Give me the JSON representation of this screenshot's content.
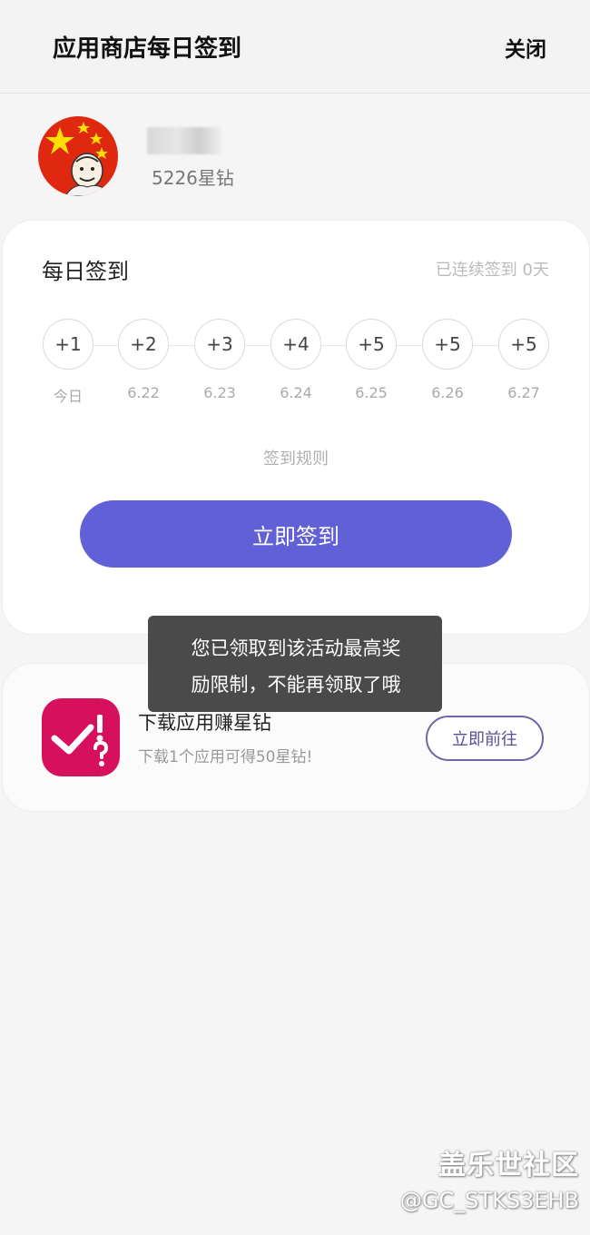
{
  "header": {
    "title": "应用商店每日签到",
    "close_label": "关闭"
  },
  "user": {
    "stars": "5226星钻"
  },
  "signin": {
    "title": "每日签到",
    "streak": "已连续签到 0天",
    "days": [
      {
        "points": "+1",
        "label": "今日"
      },
      {
        "points": "+2",
        "label": "6.22"
      },
      {
        "points": "+3",
        "label": "6.23"
      },
      {
        "points": "+4",
        "label": "6.24"
      },
      {
        "points": "+5",
        "label": "6.25"
      },
      {
        "points": "+5",
        "label": "6.26"
      },
      {
        "points": "+5",
        "label": "6.27"
      }
    ],
    "rules_label": "签到规则",
    "button_label": "立即签到"
  },
  "task": {
    "title": "下载应用赚星钻",
    "desc": "下载1个应用可得50星钻!",
    "button_label": "立即前往"
  },
  "toast": {
    "line1": "您已领取到该活动最高奖",
    "line2": "励限制，不能再领取了哦"
  },
  "watermark": {
    "brand": "盖乐世社区",
    "user": "@GC_STKS3EHB"
  },
  "colors": {
    "accent": "#6160d6",
    "app_icon": "#d6105c"
  }
}
